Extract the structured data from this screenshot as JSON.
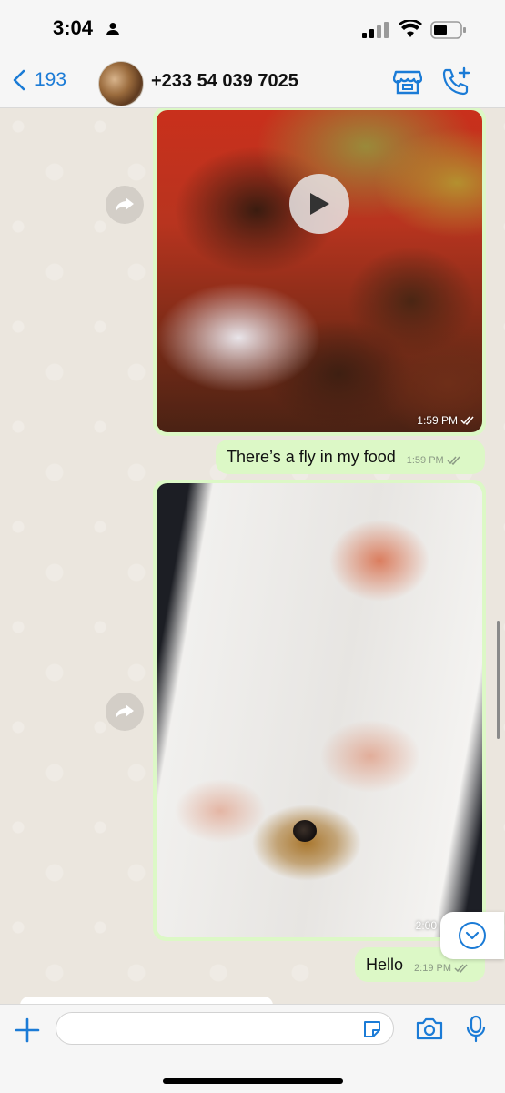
{
  "status_bar": {
    "time": "3:04"
  },
  "header": {
    "back_count": "193",
    "contact": "+233 54 039 7025"
  },
  "messages": {
    "video": {
      "time": "1:59 PM"
    },
    "text1": {
      "text": "There’s a fly in my food",
      "time": "1:59 PM"
    },
    "image": {
      "time": "2:00"
    },
    "text2": {
      "text": "Hello",
      "time": "2:19 PM"
    }
  },
  "composer": {
    "value": "",
    "placeholder": ""
  },
  "colors": {
    "accent": "#1b7bd6",
    "bubble": "#dcf8c6",
    "wallpaper": "#ebe6de"
  }
}
